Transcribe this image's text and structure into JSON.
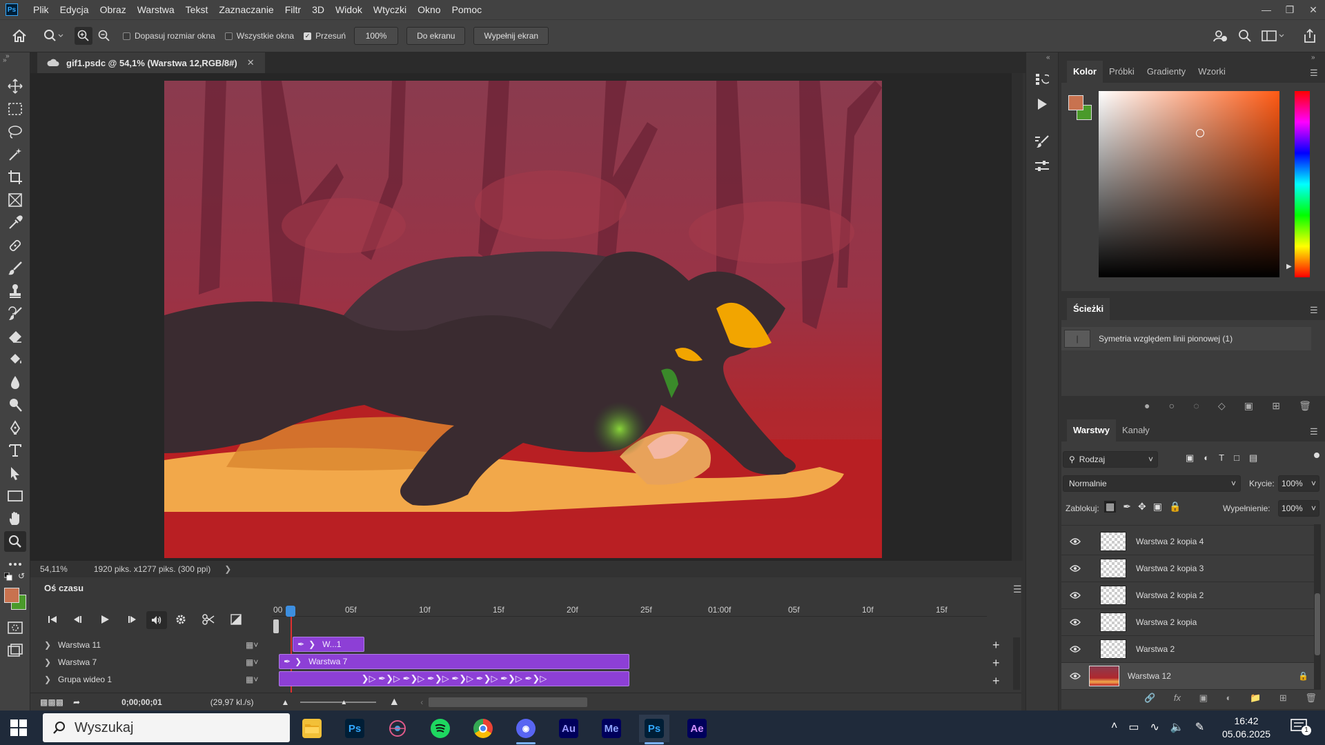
{
  "app": {
    "logo": "Ps",
    "menu": [
      "Plik",
      "Edycja",
      "Obraz",
      "Warstwa",
      "Tekst",
      "Zaznaczanie",
      "Filtr",
      "3D",
      "Widok",
      "Wtyczki",
      "Okno",
      "Pomoc"
    ]
  },
  "options": {
    "fit_window": "Dopasuj rozmiar okna",
    "all_windows": "Wszystkie okna",
    "scrubby": "Przesuń",
    "zoom_value": "100%",
    "fit_screen": "Do ekranu",
    "fill_screen": "Wypełnij ekran"
  },
  "document": {
    "tab_title": "gif1.psdc @ 54,1% (Warstwa 12,RGB/8#)"
  },
  "status": {
    "zoom": "54,11%",
    "size": "1920 piks. x1277 piks. (300 ppi)"
  },
  "timeline": {
    "title": "Oś czasu",
    "ruler": [
      "00",
      "05f",
      "10f",
      "15f",
      "20f",
      "25f",
      "01:00f",
      "05f",
      "10f",
      "15f"
    ],
    "tracks": [
      {
        "name": "Warstwa 11",
        "clip": "W...1"
      },
      {
        "name": "Warstwa 7",
        "clip": "Warstwa 7"
      },
      {
        "name": "Grupa wideo 1",
        "clip": ""
      }
    ],
    "timecode": "0;00;00;01",
    "fps": "(29,97 kl./s)"
  },
  "color_panel": {
    "tabs": [
      "Kolor",
      "Próbki",
      "Gradienty",
      "Wzorki"
    ],
    "foreground": "#c8724f",
    "background": "#4a9a2a"
  },
  "paths_panel": {
    "tab": "Ścieżki",
    "item": "Symetria względem linii pionowej (1)"
  },
  "layers_panel": {
    "tabs": [
      "Warstwy",
      "Kanały"
    ],
    "filter_kind": "Rodzaj",
    "blend_mode": "Normalnie",
    "opacity_label": "Krycie:",
    "opacity_value": "100%",
    "lock_label": "Zablokuj:",
    "fill_label": "Wypełnienie:",
    "fill_value": "100%",
    "layers": [
      {
        "name": "Warstwa 2 kopia 4"
      },
      {
        "name": "Warstwa 2 kopia 3"
      },
      {
        "name": "Warstwa 2 kopia 2"
      },
      {
        "name": "Warstwa 2 kopia"
      },
      {
        "name": "Warstwa 2"
      },
      {
        "name": "Warstwa 12"
      }
    ]
  },
  "taskbar": {
    "search": "Wyszukaj",
    "time": "16:42",
    "date": "05.06.2025",
    "notifications": "1"
  }
}
